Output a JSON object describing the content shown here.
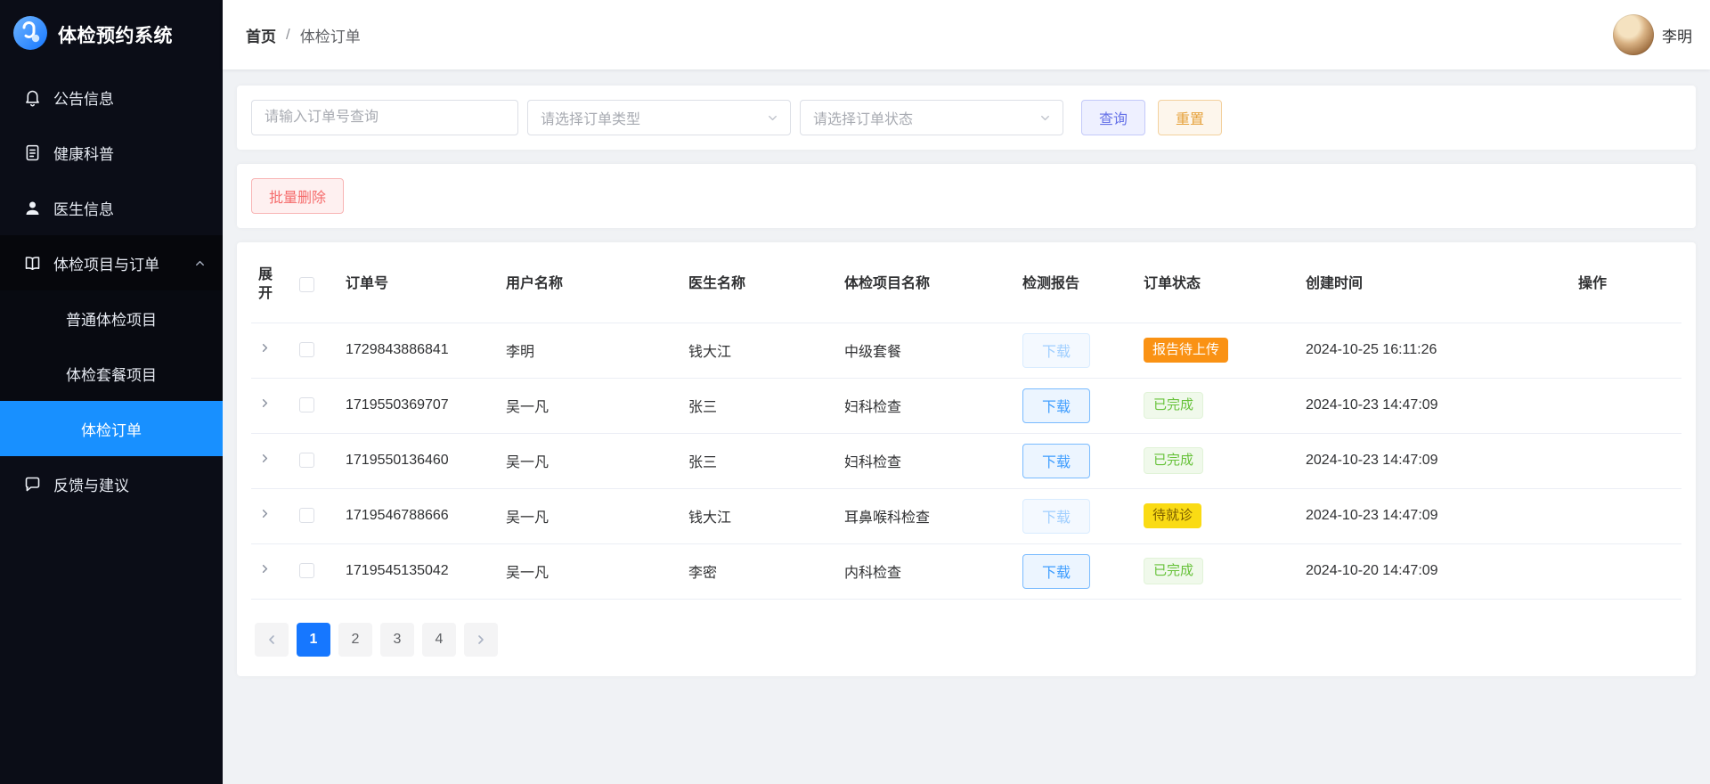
{
  "app": {
    "title": "体检预约系统"
  },
  "sidebar": {
    "items": [
      {
        "label": "公告信息"
      },
      {
        "label": "健康科普"
      },
      {
        "label": "医生信息"
      },
      {
        "label": "体检项目与订单",
        "expanded": true,
        "children": [
          {
            "label": "普通体检项目"
          },
          {
            "label": "体检套餐项目"
          },
          {
            "label": "体检订单",
            "active": true
          }
        ]
      },
      {
        "label": "反馈与建议"
      }
    ]
  },
  "header": {
    "breadcrumb": {
      "home": "首页",
      "separator": "/",
      "current": "体检订单"
    },
    "user_name": "李明"
  },
  "filters": {
    "order_no_placeholder": "请输入订单号查询",
    "order_type_placeholder": "请选择订单类型",
    "order_status_placeholder": "请选择订单状态",
    "search_label": "查询",
    "reset_label": "重置"
  },
  "actions": {
    "batch_delete_label": "批量删除"
  },
  "table": {
    "columns": {
      "expand": "展开",
      "order_no": "订单号",
      "user": "用户名称",
      "doctor": "医生名称",
      "project": "体检项目名称",
      "report": "检测报告",
      "status": "订单状态",
      "created": "创建时间",
      "action": "操作"
    },
    "download_label": "下载",
    "rows": [
      {
        "order_no": "1729843886841",
        "user": "李明",
        "doctor": "钱大江",
        "project": "中级套餐",
        "download_enabled": false,
        "status": "报告待上传",
        "created": "2024-10-25 16:11:26"
      },
      {
        "order_no": "1719550369707",
        "user": "吴一凡",
        "doctor": "张三",
        "project": "妇科检查",
        "download_enabled": true,
        "status": "已完成",
        "created": "2024-10-23 14:47:09"
      },
      {
        "order_no": "1719550136460",
        "user": "吴一凡",
        "doctor": "张三",
        "project": "妇科检查",
        "download_enabled": true,
        "status": "已完成",
        "created": "2024-10-23 14:47:09"
      },
      {
        "order_no": "1719546788666",
        "user": "吴一凡",
        "doctor": "钱大江",
        "project": "耳鼻喉科检查",
        "download_enabled": false,
        "status": "待就诊",
        "created": "2024-10-23 14:47:09"
      },
      {
        "order_no": "1719545135042",
        "user": "吴一凡",
        "doctor": "李密",
        "project": "内科检查",
        "download_enabled": true,
        "status": "已完成",
        "created": "2024-10-20 14:47:09"
      }
    ]
  },
  "pagination": {
    "pages": [
      "1",
      "2",
      "3",
      "4"
    ],
    "active": "1"
  },
  "colors": {
    "primary": "#1890ff",
    "sidebar_bg": "#0b0d17",
    "status_report_pending": "#fa9214",
    "status_done_text": "#67c23a",
    "status_waiting_bg": "#fadb14",
    "danger": "#f56c6c"
  }
}
